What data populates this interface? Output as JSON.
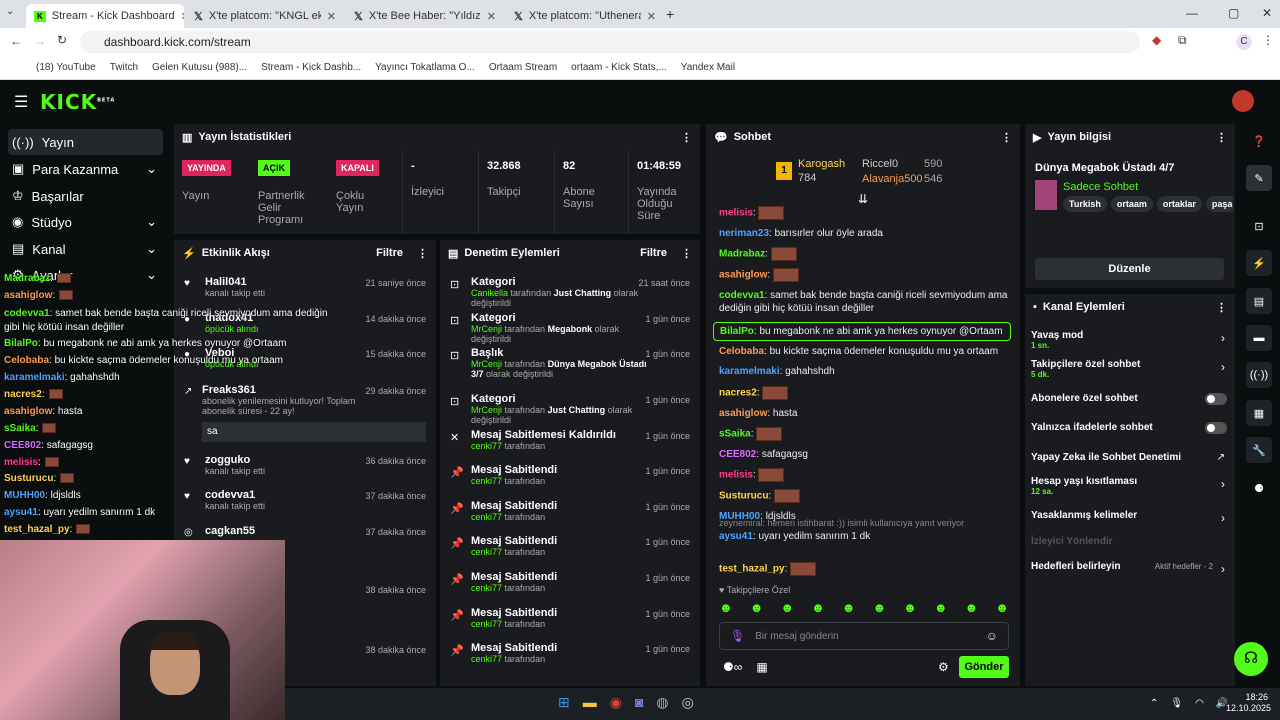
{
  "browser": {
    "tabs": [
      {
        "title": "Stream - Kick Dashboard"
      },
      {
        "title": "X'te platcom: \"KNGL ekibiyle g..."
      },
      {
        "title": "X'te Bee Haber: \"Yıldız Tilbe, m..."
      },
      {
        "title": "X'te platcom: \"Uthenera, KNGL..."
      }
    ],
    "url": "dashboard.kick.com/stream",
    "bookmarks": [
      "(18) YouTube",
      "Twitch",
      "Gelen Kutusu (988)...",
      "Stream - Kick Dashb...",
      "Yayıncı Tokatlama O...",
      "Ortaam Stream",
      "ortaam - Kick Stats,...",
      "Yandex Mail"
    ],
    "profile": "C"
  },
  "nav": {
    "logo": "KICK",
    "beta": "BETA"
  },
  "sidebar": {
    "items": [
      {
        "label": "Yayın",
        "icon": "broadcast-icon"
      },
      {
        "label": "Para Kazanma",
        "icon": "money-icon"
      },
      {
        "label": "Başarılar",
        "icon": "trophy-icon"
      },
      {
        "label": "Stüdyo",
        "icon": "studio-icon"
      },
      {
        "label": "Kanal",
        "icon": "channel-icon"
      },
      {
        "label": "Ayarlar",
        "icon": "gear-icon"
      }
    ]
  },
  "stats": {
    "title": "Yayın İstatistikleri",
    "items": [
      {
        "badge": "YAYINDA",
        "label": "Yayın",
        "color": "#e0245e"
      },
      {
        "badge": "AÇIK",
        "label": "Partnerlik Gelir Programı",
        "color": "#53fc18"
      },
      {
        "badge": "KAPALI",
        "label": "Çoklu Yayın",
        "color": "#e0245e"
      },
      {
        "value": "-",
        "label": "İzleyici"
      },
      {
        "value": "32.868",
        "label": "Takipçi"
      },
      {
        "value": "82",
        "label": "Abone Sayısı"
      },
      {
        "value": "01:48:59",
        "label": "Yayında Olduğu Süre"
      }
    ]
  },
  "activity": {
    "title": "Etkinlik Akışı",
    "filter": "Filtre",
    "items": [
      {
        "name": "Halil041",
        "desc": "kanalı takip etti",
        "time": "21 saniye önce"
      },
      {
        "name": "thadox41",
        "desc": "öpücük alındı",
        "time": "14 dakika önce"
      },
      {
        "name": "Veboi",
        "desc": "öpücük alındı",
        "time": "15 dakika önce"
      },
      {
        "name": "Freaks361",
        "desc": "abonelik yenilemesini kutluyor! Toplam abonelik süresi - 22 ay!",
        "time": "29 dakika önce",
        "msg": "sa"
      },
      {
        "name": "zogguko",
        "desc": "kanalı takip etti",
        "time": "36 dakika önce"
      },
      {
        "name": "codevva1",
        "desc": "kanalı takip etti",
        "time": "37 dakika önce"
      },
      {
        "name": "cagkan55",
        "desc": "",
        "time": "37 dakika önce"
      },
      {
        "name": "",
        "desc": "",
        "time": "38 dakika önce"
      },
      {
        "name": "",
        "desc": "",
        "time": "38 dakika önce"
      }
    ]
  },
  "moderation": {
    "title": "Denetim Eylemleri",
    "filter": "Filtre",
    "items": [
      {
        "title": "Kategori",
        "user": "Canikella",
        "mid": "tarafından",
        "target": "Just Chatting",
        "end": "olarak değiştirildi",
        "time": "21 saat önce"
      },
      {
        "title": "Kategori",
        "user": "MrCenji",
        "mid": "tarafından",
        "target": "Megabonk",
        "end": "olarak değiştirildi",
        "time": "1 gün önce"
      },
      {
        "title": "Başlık",
        "user": "MrCenji",
        "mid": "tarafından",
        "target": "Dünya Megabok Üstadı 3/7",
        "end": "olarak değiştirildi",
        "time": "1 gün önce"
      },
      {
        "title": "Kategori",
        "user": "MrCenji",
        "mid": "tarafından",
        "target": "Just Chatting",
        "end": "olarak değiştirildi",
        "time": "1 gün önce"
      },
      {
        "title": "Mesaj Sabitlemesi Kaldırıldı",
        "user": "cenki77",
        "mid": "tarafından",
        "target": "",
        "end": "",
        "time": "1 gün önce"
      },
      {
        "title": "Mesaj Sabitlendi",
        "user": "cenki77",
        "mid": "tarafından",
        "target": "",
        "end": "",
        "time": "1 gün önce"
      },
      {
        "title": "Mesaj Sabitlendi",
        "user": "cenki77",
        "mid": "tarafından",
        "target": "",
        "end": "",
        "time": "1 gün önce"
      },
      {
        "title": "Mesaj Sabitlendi",
        "user": "cenki77",
        "mid": "tarafından",
        "target": "",
        "end": "",
        "time": "1 gün önce"
      },
      {
        "title": "Mesaj Sabitlendi",
        "user": "cenki77",
        "mid": "tarafından",
        "target": "",
        "end": "",
        "time": "1 gün önce"
      },
      {
        "title": "Mesaj Sabitlendi",
        "user": "cenki77",
        "mid": "tarafından",
        "target": "",
        "end": "",
        "time": "1 gün önce"
      },
      {
        "title": "Mesaj Sabitlendi",
        "user": "cenki77",
        "mid": "tarafından",
        "target": "",
        "end": "",
        "time": "1 gün önce"
      }
    ]
  },
  "chat": {
    "title": "Sohbet",
    "leaders": {
      "first": {
        "rank": "1",
        "name": "Karogash",
        "value": "784"
      },
      "second": {
        "name": "Riccel0",
        "value": "590"
      },
      "third": {
        "name": "Alavanja500",
        "value": "546"
      }
    },
    "messages": [
      {
        "user": "melisis",
        "text": "",
        "color": "#ff3f8b"
      },
      {
        "user": "neriman23",
        "text": "barısırler olur öyle arada",
        "color": "#4fa3ff"
      },
      {
        "user": "Madrabaz",
        "text": "",
        "color": "#53fc18"
      },
      {
        "user": "asahiglow",
        "text": "",
        "color": "#ff9b4f"
      },
      {
        "user": "codevva1",
        "text": "samet bak bende başta caniği riceli sevmiyodum ama dediğin gibi hiç kötüü insan değiller",
        "color": "#53fc18"
      },
      {
        "user": "BilalPo",
        "text": "bu megabonk ne abi amk ya herkes oynuyor @Ortaam",
        "color": "#53fc18"
      },
      {
        "user": "Celobaba",
        "text": "bu kickte saçma ödemeler konuşuldu mu ya ortaam",
        "color": "#ff9b4f"
      },
      {
        "user": "karamelmaki",
        "text": "gahahshdh",
        "color": "#4fa3ff"
      },
      {
        "user": "nacres2",
        "text": "",
        "color": "#ffd54f"
      },
      {
        "user": "asahiglow",
        "text": "hasta",
        "color": "#ff9b4f"
      },
      {
        "user": "sSaika",
        "text": "",
        "color": "#53fc18"
      },
      {
        "user": "CEE802",
        "text": "safagagsg",
        "color": "#d86bff"
      },
      {
        "user": "melisis",
        "text": "",
        "color": "#ff3f8b"
      },
      {
        "user": "Susturucu",
        "text": "",
        "color": "#ffd54f"
      },
      {
        "user": "MUHH00",
        "text": "ldjsldls",
        "color": "#4fa3ff"
      },
      {
        "user": "aysu41",
        "text": "uyarı yedilm sanırım 1 dk",
        "color": "#4fa3ff",
        "reply": "zeynemiral: hemen istihbarat :)) isimli kullanıcıya yanıt veriyor"
      },
      {
        "user": "test_hazal_py",
        "text": "",
        "color": "#ffd54f"
      }
    ],
    "followers_only": "Takipçilere Özel",
    "placeholder": "Bir mesaj gönderin",
    "send": "Gönder"
  },
  "info": {
    "title": "Yayın bilgisi",
    "stream_title": "Dünya Megabok Üstadı 4/7",
    "category": "Sadece Sohbet",
    "tags": [
      "Turkish",
      "ortaam",
      "ortaklar",
      "paşala"
    ],
    "edit": "Düzenle"
  },
  "channel_actions": {
    "title": "Kanal Eylemleri",
    "items": [
      {
        "label": "Yavaş mod",
        "sub": "1 sn.",
        "kind": "arrow"
      },
      {
        "label": "Takipçilere özel sohbet",
        "sub": "5 dk.",
        "kind": "arrow"
      },
      {
        "label": "Abonelere özel sohbet",
        "sub": "",
        "kind": "toggle"
      },
      {
        "label": "Yalnızca ifadelerle sohbet",
        "sub": "",
        "kind": "toggle"
      },
      {
        "label": "Yapay Zeka ile Sohbet Denetimi",
        "sub": "",
        "kind": "ext"
      },
      {
        "label": "Hesap yaşı kısıtlaması",
        "sub": "12 sa.",
        "kind": "arrow"
      },
      {
        "label": "Yasaklanmış kelimeler",
        "sub": "",
        "kind": "arrow"
      },
      {
        "label": "İzleyici Yönlendir",
        "sub": "",
        "kind": "disabled"
      },
      {
        "label": "Hedefleri belirleyin",
        "sub": "",
        "kind": "arrow",
        "badge": "Aktif hedefler - 2"
      }
    ]
  },
  "overlay_chat": [
    {
      "user": "Madrabaz",
      "text": ":",
      "color": "#53fc18"
    },
    {
      "user": "asahiglow",
      "text": ":",
      "color": "#ff9b4f"
    },
    {
      "user": "codevva1",
      "text": ": samet bak bende başta caniği riceli sevmiyodum ama dediğin gibi hiç kötüü insan değiller",
      "color": "#53fc18"
    },
    {
      "user": "BilalPo",
      "text": ": bu megabonk ne abi amk ya herkes oynuyor @Ortaam",
      "color": "#53fc18"
    },
    {
      "user": "Celobaba",
      "text": ": bu kickte saçma ödemeler konuşuldu mu ya ortaam",
      "color": "#ff9b4f"
    },
    {
      "user": "karamelmaki",
      "text": ": gahahshdh",
      "color": "#4fa3ff"
    },
    {
      "user": "nacres2",
      "text": ":",
      "color": "#ffd54f"
    },
    {
      "user": "asahiglow",
      "text": ": hasta",
      "color": "#ff9b4f"
    },
    {
      "user": "sSaika",
      "text": ":",
      "color": "#53fc18"
    },
    {
      "user": "CEE802",
      "text": ": safagagsg",
      "color": "#d86bff"
    },
    {
      "user": "melisis",
      "text": ":",
      "color": "#ff3f8b"
    },
    {
      "user": "Susturucu",
      "text": ":",
      "color": "#ffd54f"
    },
    {
      "user": "MUHH00",
      "text": ": ldjsldls",
      "color": "#4fa3ff"
    },
    {
      "user": "aysu41",
      "text": ": uyarı yedilm sanırım 1 dk",
      "color": "#4fa3ff"
    },
    {
      "user": "test_hazal_py",
      "text": ":",
      "color": "#ffd54f"
    }
  ],
  "taskbar": {
    "time": "18:26",
    "date": "12.10.2025"
  }
}
